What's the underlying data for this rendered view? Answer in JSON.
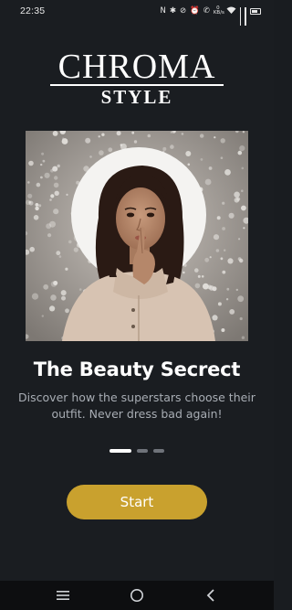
{
  "status_bar": {
    "time": "22:35",
    "net_speed": "0\nKB/s",
    "icons": [
      "nfc-icon",
      "bluetooth-icon",
      "mute-icon",
      "alarm-icon",
      "call-icon",
      "wifi-icon",
      "signal-icon",
      "signal-icon",
      "battery-icon"
    ]
  },
  "logo": {
    "main": "CHROMA",
    "sub": "STYLE"
  },
  "onboarding": {
    "title": "The Beauty Secrect",
    "subtitle": "Discover how the superstars choose their outfit. Never dress bad again!",
    "page_count": 3,
    "active_page": 0
  },
  "start_button": {
    "label": "Start"
  },
  "colors": {
    "background": "#1a1d21",
    "accent": "#c9a12e",
    "text_primary": "#ffffff",
    "text_secondary": "#a8adb4",
    "nav_bar": "#0d0e10"
  },
  "nav_bar": {
    "items": [
      "menu-icon",
      "home-icon",
      "back-icon"
    ]
  }
}
